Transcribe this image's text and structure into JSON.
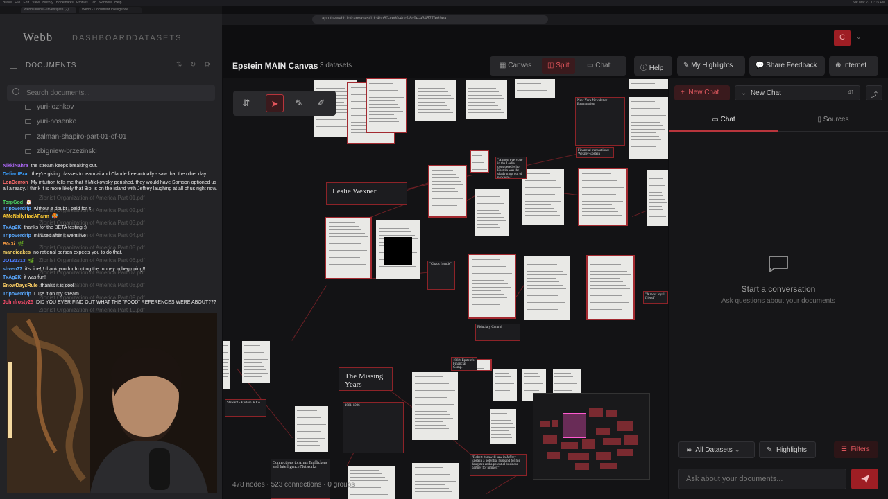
{
  "system": {
    "menubar_apps": [
      "Brave",
      "File",
      "Edit",
      "View",
      "History",
      "Bookmarks",
      "Profiles",
      "Tab",
      "Window",
      "Help"
    ],
    "clock": "Sat Mar 27  11:15 PM"
  },
  "browser": {
    "tabs": [
      "Webb Online - Investigate (2)",
      "Webb - Document Intelligence"
    ],
    "url": "app.thewebb.io/canvases/1dc4bb60-ce60-4dcf-8c9e-a34577fe69ea"
  },
  "app": {
    "logo": "Webb",
    "nav": [
      "DASHBOARD",
      "DATASETS"
    ],
    "avatar_initial": "C"
  },
  "sidebar": {
    "title": "DOCUMENTS",
    "search_placeholder": "Search documents...",
    "tree": [
      "yuri-lozhkov",
      "yuri-nosenko",
      "zalman-shapiro-part-01-of-01",
      "zbigniew-brzezinski"
    ],
    "files": [
      "Zionist Organization of America Part 01.pdf",
      "Zionist Organization of America Part 02.pdf",
      "Zionist Organization of America Part 03.pdf",
      "Zionist Organization of America Part 04.pdf",
      "Zionist Organization of America Part 05.pdf",
      "Zionist Organization of America Part 06.pdf",
      "Zionist Organization of America Part 07.pdf",
      "Zionist Organization of America Part 08.pdf",
      "Zionist Organization of America Part 09.pdf",
      "Zionist Organization of America Part 10.pdf"
    ]
  },
  "stream_chat": [
    {
      "user": "NikkiNahra",
      "color": "#b36bff",
      "text": "the stream keeps breaking out."
    },
    {
      "user": "DefiantBrat",
      "color": "#3aa0ff",
      "text": "they're giving classes to learn ai and Claude free actually - saw that the other day"
    },
    {
      "user": "LonDemon",
      "color": "#ff6b6b",
      "text": "My intuition tells me that if Milekowsky perished, they would have Samson optioned us all already. I think it is more likely that Bibi is on the island with Jeffrey laughing at all of us right now."
    },
    {
      "user": "TorpGod",
      "color": "#4cd964",
      "text": "🎅"
    },
    {
      "user": "Tripoverdrip",
      "color": "#5aa9ff",
      "text": "without a doubt I paid for it"
    },
    {
      "user": "AMcNallyHadAFarm",
      "color": "#ffcc33",
      "text": "🥵"
    },
    {
      "user": "TxAg2K",
      "color": "#5aa9ff",
      "text": "thanks for the BETA testing :)"
    },
    {
      "user": "Tripoverdrip",
      "color": "#5aa9ff",
      "text": "minutes after it went live"
    },
    {
      "user": "B0r3i",
      "color": "#ff9f43",
      "text": "🌿"
    },
    {
      "user": "mandicakes",
      "color": "#f6d365",
      "text": "no rational person expects you to do that."
    },
    {
      "user": "JO131313",
      "color": "#4d7cff",
      "text": "🌿"
    },
    {
      "user": "shven77",
      "color": "#5aa9ff",
      "text": "it's fine!!! thank you for fronting the money in beginning!!"
    },
    {
      "user": "TxAg2K",
      "color": "#5aa9ff",
      "text": "it was fun!"
    },
    {
      "user": "SnowDaysRule",
      "color": "#ffd166",
      "text": "thanks it is cool"
    },
    {
      "user": "Tripoverdrip",
      "color": "#5aa9ff",
      "text": "I use it on my stream"
    },
    {
      "user": "Johnfrosty25",
      "color": "#ff4d6d",
      "text": "DID YOU EVER FIND OUT WHAT THE \"FOOD\" REFERENCES WERE ABOUT???"
    }
  ],
  "header": {
    "canvas_title": "Epstein MAIN Canvas",
    "dataset_count": "3 datasets",
    "views": [
      "Canvas",
      "Split",
      "Chat"
    ],
    "active_view": "Split",
    "buttons": [
      "Help",
      "My Highlights",
      "Share Feedback",
      "Internet"
    ]
  },
  "canvas": {
    "cards": {
      "leslie": "Leslie Wexner",
      "missing": "The Missing Years",
      "nyt": "New York Newsletter Examination",
      "financial": "Financial transactions: Wexner-Epstein",
      "chaos": "\"Chaos friends\"",
      "almost": "\"Almost everyone in the Leslie ... considered who Epstein was the shady most out of nowhere.\"",
      "loyal": "\"A most loyal friend\"",
      "timeline": "1981-1986",
      "arms": "Connections to Arms Traffickers and Intelligence Networks",
      "maxwell": "\"Robert Maxwell saw in Jeffrey Epstein a potential husband for his daughter and a potential business partner for himself\"",
      "fiduciary": "Fiduciary Control",
      "stewart": "Steward - Epstein & Co.",
      "financial_comp": "1982: Epstein's Financial Comp."
    },
    "status": "478 nodes · 523 connections · 0 groups"
  },
  "chat_panel": {
    "new_chat_label": "New Chat",
    "select_label": "New Chat",
    "select_count": "41",
    "tabs": [
      "Chat",
      "Sources"
    ],
    "empty_title": "Start a conversation",
    "empty_subtitle": "Ask questions about your documents",
    "datasets_filter": "All Datasets",
    "highlights_label": "Highlights",
    "filters_label": "Filters",
    "input_placeholder": "Ask about your documents..."
  },
  "colors": {
    "accent": "#b8353c",
    "accent_dark": "#9e1e24",
    "panel": "#232326",
    "canvas_bg": "#131315"
  },
  "icons": [
    "columns-icon",
    "split-icon",
    "chat-bubble-icon",
    "help-circle-icon",
    "highlighter-icon",
    "feedback-icon",
    "globe-icon",
    "share-icon",
    "database-icon",
    "filter-icon",
    "send-icon",
    "folder-icon",
    "search-icon",
    "pointer-icon",
    "pen-icon",
    "pan-icon"
  ]
}
